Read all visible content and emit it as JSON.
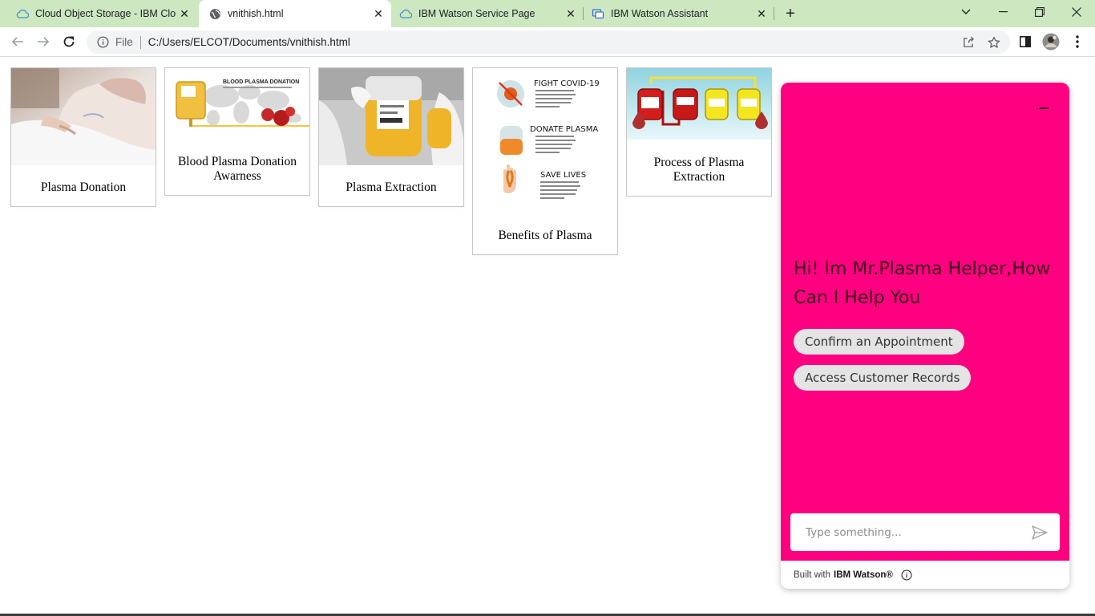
{
  "browser": {
    "tabs": [
      {
        "title": "Cloud Object Storage - IBM Clou",
        "icon": "cloud-icon",
        "active": false
      },
      {
        "title": "vnithish.html",
        "icon": "globe-icon",
        "active": true
      },
      {
        "title": "IBM Watson Service Page",
        "icon": "cloud-icon",
        "active": false
      },
      {
        "title": "IBM Watson Assistant",
        "icon": "assistant-icon",
        "active": false
      }
    ],
    "close_glyph": "✕",
    "new_tab_glyph": "+",
    "address": {
      "scheme": "File",
      "url": "C:/Users/ELCOT/Documents/vnithish.html"
    },
    "colors": {
      "tabstrip": "#cde8c0",
      "omnibox": "#f1f3f4"
    }
  },
  "cards": [
    {
      "caption": "Plasma Donation",
      "image": "hospital-patient-photo"
    },
    {
      "caption": "Blood Plasma Donation Awarness",
      "image": "plasma-donation-banner",
      "banner_title": "BLOOD PLASMA DONATION"
    },
    {
      "caption": "Plasma Extraction",
      "image": "plasma-bag-photo"
    },
    {
      "caption": "Benefits of Plasma",
      "image": "benefits-infographic",
      "items": [
        "FIGHT COVID-19",
        "DONATE PLASMA",
        "SAVE LIVES"
      ]
    },
    {
      "caption": "Process of Plasma Extraction",
      "image": "plasma-process-illustration"
    }
  ],
  "chat": {
    "greeting": "Hi! Im Mr.Plasma Helper,How Can I Help You",
    "options": [
      "Confirm an Appointment",
      "Access Customer Records"
    ],
    "input_placeholder": "Type something...",
    "footer_prefix": "Built with",
    "footer_brand": "IBM Watson®",
    "colors": {
      "header": "#ff0080",
      "option_bg": "#e4e4e4"
    }
  }
}
